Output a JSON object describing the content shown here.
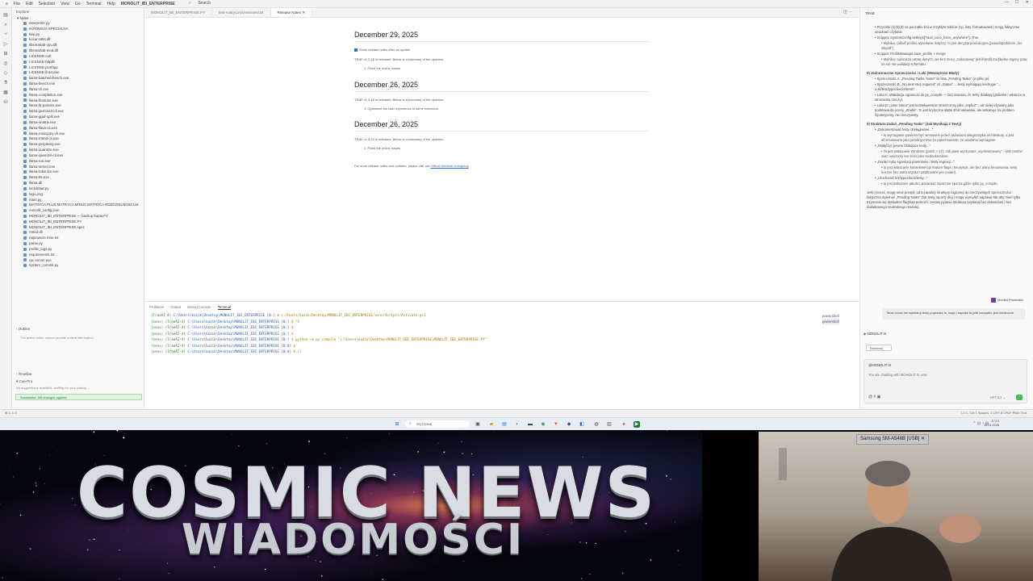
{
  "topbar": {
    "menus": [
      "File",
      "Edit",
      "Selection",
      "View",
      "Go",
      "Terminal",
      "Help"
    ],
    "project": "MONOLIT_IBI_ENTERPRISE",
    "search": "Search"
  },
  "explorer": {
    "header": "Explorer",
    "folder": "folder",
    "files": [
      "interpreter.py",
      "KONWISJA SPECIALNA",
      "kiwi.py",
      "kocur-attrs.dll",
      "libsmartab-cpu.dll",
      "libsmartab-mod.dll",
      "LICENSE-curl",
      "LICENSE-httplib",
      "LICENSE-jsonhpp",
      "LICENSE-linenoise",
      "llama-batched-bench.exe",
      "llama-bench.exe",
      "llama-cli.exe",
      "llama-completion.exe",
      "llama-finetune.exe",
      "llama-fit-params.exe",
      "llama-gemma3-cli.exe",
      "llama-gguf-split.exe",
      "llama-imatrix.exe",
      "llama-llava-cli.exe",
      "llama-minicpmv-cli.exe",
      "llama-mtmd-cli.exe",
      "llama-perplexity.exe",
      "llama-quantize.exe",
      "llama-qwen2vl-cli.exe",
      "llama-run.exe",
      "llama-server.exe",
      "llama-tokenize.exe",
      "llama-tts.exe",
      "llama.dll",
      "lockimbar.py",
      "logo.png",
      "main.py",
      "MATRYCA PLUS MATRYCA MINUS MATRYCA ROZDZIELNOSCI.txt",
      "monolit_config.json",
      "MONOLIT_IBI_ENTERPRISE — backup kopia.PY",
      "MONOLIT_IBI_ENTERPRISE.PY",
      "MONOLIT_IBI_ENTERPRISE.spec",
      "mtmd.dll",
      "najnowsze mne.txt",
      "parse.py",
      "profile_logs.py",
      "requirements.txt",
      "rpc-server.exe",
      "system_commit.py"
    ],
    "outline_header": "Outline",
    "outline_msg": "The active editor cannot provide outline information.",
    "timeline_header": "Timeline",
    "cue_header": "Cue-Pro",
    "cue_msg": "No suggestions available, waiting for your coding...",
    "success_msg": "Successful: 0/0 changes applied"
  },
  "tabs": [
    {
      "label": "MONOLIT_IBI_ENTERPRISE.PY",
      "active": false
    },
    {
      "label": "test-matryca-przewsinew.txt",
      "active": false
    },
    {
      "label": "Release Notes",
      "active": true
    }
  ],
  "release_notes": {
    "checkbox_label": "Show release notes after an update",
    "footer_prefix": "For more release notes and updates, please visit our ",
    "footer_link": "Official Website changelog",
    "sections": [
      {
        "date": "December 29, 2025",
        "summary": "TRAE v1.5.16 is released. Below is a summary of the updates:",
        "item": "1. Fixed the online issues."
      },
      {
        "date": "December 26, 2025",
        "summary": "TRAE v1.5.15 is released. Below is a summary of the updates:",
        "item": "1. Optimized the user experience in some scenarios."
      },
      {
        "date": "December 26, 2025",
        "summary": "TRAE v1.5.14 is released. Below is a summary of the updates:",
        "item": "1. Fixed the online issues."
      }
    ]
  },
  "panel": {
    "tabs": [
      "Problems",
      "Output",
      "Debug Console",
      "Terminal"
    ],
    "shells": [
      "powershell",
      "powershell"
    ],
    "lines": [
      {
        "env": "(TraeAI-4)",
        "prompt": "C:\\Users\\kazik\\Desktop\\MONOLIT_IBI_ENTERPRISE [0:]",
        "cmd": "$ c:/Users/kazik/Desktop/MONOLIT_IBI_ENTERPRISE/venv/Scripts/Activate.ps1"
      },
      {
        "env": "(venv) (TraeAI-4)",
        "prompt": "C:\\Users\\kazik\\Desktop\\MONOLIT_IBI_ENTERPRISE [0:]",
        "cmd": "$ ^C"
      },
      {
        "env": "(venv) (TraeAI-4)",
        "prompt": "C:\\Users\\kazik\\Desktop\\MONOLIT_IBI_ENTERPRISE [0:]",
        "cmd": "$"
      },
      {
        "env": "(venv) (TraeAI-4)",
        "prompt": "C:\\Users\\kazik\\Desktop\\MONOLIT_IBI_ENTERPRISE [0:]",
        "cmd": "$"
      },
      {
        "env": "(venv) (TraeAI-4)",
        "prompt": "C:\\Users\\kazik\\Desktop\\MONOLIT_IBI_ENTERPRISE [0:]",
        "cmd": "$ python -m py_compile \"c:\\Users\\kazik\\Desktop\\MONOLIT_IBI_ENTERPRISE\\MONOLIT_IBI_ENTERPRISE.PY\""
      },
      {
        "env": "(venv) (TraeAI-4)",
        "prompt": "C:\\Users\\kazik\\Desktop\\MONOLIT_IBI_ENTERPRISE [0:0]",
        "cmd": "$"
      },
      {
        "env": "(venv) (TraeAI-4)",
        "prompt": "C:\\Users\\kazik\\Desktop\\MONOLIT_IBI_ENTERPRISE [0:0]",
        "cmd": "$ []"
      }
    ]
  },
  "chat": {
    "title": "TRAE",
    "blocks": [
      {
        "t": "bl",
        "text": "Przyciski (1)(2)(3) na początku linii w zrzykłym tekście (np. listy, formatowanie) mogą faktycznie utrudniać czytanie."
      },
      {
        "t": "bl",
        "text": "Snippet: SystemConfig.settings[\"rauti_coco_force_anywhere\"]=True"
      },
      {
        "t": "bl2",
        "text": "Mylnika: (aktuff prefiks wywołanie dotyczy: to jest decyzja produkcyjna (prawdopodobnie „fox wkyaill\")."
      },
      {
        "t": "bl",
        "text": "Snippet: ProfileManager.save_profile + merge"
      },
      {
        "t": "bl2",
        "text": "Mylnika: ogranicza utratę danych, ale bez mocy „zadaniowej\" jeżeli profil ma błędne legacy pola; bo nie ma walidacji schematu."
      },
      {
        "t": "sec",
        "text": "5) Jednoznaczne Sprzeczności i Luki (Wewnętrzne Błędy)"
      },
      {
        "t": "bl",
        "text": "Sprzeczność A: „Pending Tasks: None\" vs lista „Pending Tasks\" (w pliku je)."
      },
      {
        "t": "bl",
        "text": "Sprzeczność B: „No next step required\" vs „Status\" ... testy wymagają niedrugie \" „ Luki/test/typechecks/tests\"."
      },
      {
        "t": "bl",
        "text": "Luka C: Walidacja ogranicza do py_compile — bez dowodu, że testy działają (globalne i wkracza w strumieniu rzeczy)."
      },
      {
        "t": "bl",
        "text": "Luka D: „User intent\" jest konsekwentnie streszczony jako „implicit\" , ale dalej używany jako podstawa do oceny „Strelki\". To jest krytyczne słabe sformułowanie, ale wskazuje na problem hipotetyczny, nie rzeczywisty."
      },
      {
        "t": "sec",
        "text": "6) Struktura Zadań „Pending Tasks\" (Jak Wynikają Z Testy)"
      },
      {
        "t": "bl",
        "text": "„Dokumentować testy obsługiwane...\""
      },
      {
        "t": "bl2",
        "text": "to wymaganie powinno być sensowne przed zadaniami sitagnostyka architektury, a jest sformułowane jako pending mimo że raport twierdzi, że wiadomo wymagane."
      },
      {
        "t": "bl",
        "text": "„Wyłączyć pewne blokujące kody...\""
      },
      {
        "t": "bl2",
        "text": "To jest wskazanie Windows (patch > 17); Jak dane wyrzucane „wyeliminowany\" - blok testów: więc uważamy ten sens jako niedookreślone."
      },
      {
        "t": "bl",
        "text": "„Dodać tryby egzekucji powrotowe / testy regresji...\""
      },
      {
        "t": "bl2",
        "text": "to jest wskazanie konsekwencja feature-flags i heurystyk, ale bez planu fencowania, testy boczne bez astra szybko i profilowane per model)."
      },
      {
        "t": "bl",
        "text": "„Uruchomić lint/typecheck/testy...\""
      },
      {
        "t": "bl2",
        "text": "to jest wskazane jakości, ponieważ raport nie sporna gdzie tylko py_compile."
      },
      {
        "t": "p",
        "text": "Jeśli chcesz, mogę teraz przejść od tej analizy struktury logicznej do rzeczywistych sprzeczności - faktyczna wykonać „Pending Tasks\" (lub testy raporty dla) i mogę wymyślić naprawę tak aby mieć tylko trzymanie się dokładnie flagmap poleceń, zestaw pytanie strukturę (wydaną bez dokoszów) i bez dodatkowego neutralnego modułu)."
      }
    ],
    "user_name": "Monika Prusińska",
    "user_msg": "Teraz nowe nie wymiany testy poprawia to, tacja i napraw to jeśli wszystko jest konieczne",
    "agent_name": "MONOLIT III",
    "ask_btn": "Rozumuj",
    "composer_name": "@MONOLIT III",
    "composer_placeholder": "You are chatting with MONOLIT III now",
    "model_label": "GPT-5.2"
  },
  "statusbar": {
    "left": "⊗ 0 ⚠ 0",
    "right": "Ln 1, Col 1   Spaces: 4   UTF-8   CRLF   Plain Text"
  },
  "taskbar": {
    "search": "Wyszukaj",
    "time": "17:13",
    "date": "19.01.2026"
  },
  "stream": {
    "title_line1": "COSMIC NEWS",
    "title_line2": "WIADOMOŚCI",
    "cam_label": "Samsung SM-A546B [USB]"
  }
}
